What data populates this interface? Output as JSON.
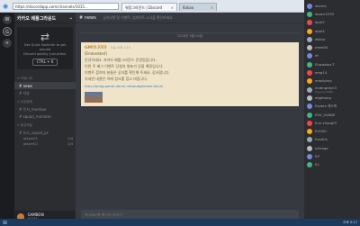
{
  "browser": {
    "address": "https://discordapp.com/channels/1015...",
    "tabs": [
      {
        "label": "워킹그라운드 | Discord",
        "close": "×"
      },
      {
        "label": "Kakao",
        "close": "×"
      }
    ]
  },
  "servers": [
    {
      "label": "W"
    },
    {
      "label": "G"
    },
    {
      "label": "+"
    }
  ],
  "guild": {
    "name": "카카오 배틀그라운드",
    "chevron": "⌄"
  },
  "quick_switcher": {
    "arrows": "⇄",
    "text1": "Use Quick Switcher to get around",
    "text2": "Discord quickly. Just press:",
    "shortcut": "CTRL + K"
  },
  "categories": [
    {
      "name": "∨ 커뮤니티",
      "channels": [
        "# news",
        "# 자유"
      ]
    },
    {
      "name": "∨ 신입멤버",
      "channels": [
        "# 인사_member",
        "# squad_member"
      ]
    },
    {
      "name": "∨ 음성채널",
      "channels": [
        "# 듀오_squad_ps"
      ]
    }
  ],
  "voice_users": [
    {
      "name": "player01",
      "count": "3/4"
    },
    {
      "name": "player02",
      "count": "2/4"
    }
  ],
  "user": {
    "name": "GAMBON",
    "tag": "#1234"
  },
  "channel_header": {
    "name": "news",
    "description": "공지사항 및 이벤트, 업데이트 소식을 확인하세요"
  },
  "date_divider": "2018년 3월 20일",
  "message": {
    "author": "GM이니이야",
    "time": "오늘 오후 2:15",
    "sub": "[Embedded]",
    "lines": [
      "안녕하세요. 카카오 배틀그라운드 운영팀입니다.",
      "이번 주 배그 이벤트 당첨자 발표가 있을 예정입니다.",
      "이벤트 참여자 분들은 공지를 확인해 주세요. 감사합니다.",
      "자세한 내용은 아래 링크를 참고 바랍니다."
    ],
    "link": "http://pubg.game.daum.net/pubg/index.daum"
  },
  "composer_placeholder": "#news에 메시지 보내기",
  "members": [
    {
      "name": "dazmo"
    },
    {
      "name": "doorrr2332"
    },
    {
      "name": "dpol2"
    },
    {
      "name": "dpol4"
    },
    {
      "name": "dsblur"
    },
    {
      "name": "eeee90"
    },
    {
      "name": "ef"
    },
    {
      "name": "Elasdabcr-T"
    },
    {
      "name": "emg14"
    },
    {
      "name": "emptykey"
    },
    {
      "name": "endingrayn3",
      "sub": "Playing PUBG"
    },
    {
      "name": "eogfoong"
    },
    {
      "name": "Espers 에스퍼"
    },
    {
      "name": "ESU_VVANS"
    },
    {
      "name": "Eun-chong이"
    },
    {
      "name": "EVOXO"
    },
    {
      "name": "ExodUs"
    },
    {
      "name": "extraqo"
    },
    {
      "name": "EZ"
    },
    {
      "name": "E2"
    }
  ],
  "taskbar": {
    "start": "⊞",
    "clock": "오후 5:17"
  },
  "colors": {
    "accent": "#c0862a",
    "embed_bg": "#efe4c9",
    "link": "#3b7ec9"
  }
}
